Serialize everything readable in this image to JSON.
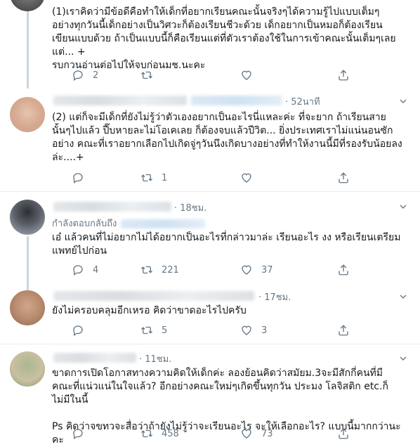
{
  "tweets": [
    {
      "time": "",
      "text": "(1)เราคิดว่ามีข้อดีคือทำให้เด็กที่อยากเรียนคณะนั้นจริงๆได้ความรู้ไปแบบเต็มๆ อย่างทุกวันนี้เด็กอย่างเป็นวิศวะก็ต้องเรียนชีวะด้วย เด็กอยากเป็นหมอก็ต้องเรียนเขียนแบบด้วย ถ้าเป็นแบบนี้ก็คือเรียนแต่ที่ตัวเราต้องใช้ในการเข้าคณะนั้นเต็มๆเลย แต่... +\nรบกวนอ่านต่อไปให้จบก่อนมช.นะคะ",
      "reply_count": "2",
      "retweet_count": "",
      "like_count": ""
    },
    {
      "time": "· 52นาที",
      "text": "(2) แต่ก็จะมีเด็กที่ยังไม่รู้ว่าตัวเองอยากเป็นอะไรนี่แหละค่ะ ที่จะยาก ถ้าเรียนสายนั้นๆไปแล้ว ปี๊บหายละไม่โอเคเลย ก็ต้องจบแล้วปีวิต... ยิ่งประเทศเราไม่แน่นอนซักอย่าง คณะที่เราอยากเลือกไปเกิดจู่ๆวันนึงเกิดบางอย่างที่ทำให้งานนี้มีที่รองรับน้อยลงล่ะ....+",
      "reply_count": "",
      "retweet_count": "1",
      "like_count": ""
    },
    {
      "time": "· 18ชม.",
      "replying_label": "กำลังตอบกลับถึง",
      "text": "เอ๋ แล้วคนที่ไม่อยากไม่ได้อยากเป็นอะไรที่กล่าวมาล่ะ เรียนอะไร งง หรือเรียนเตรียมแพทย์ไปก่อน",
      "reply_count": "4",
      "retweet_count": "221",
      "like_count": "37"
    },
    {
      "time": "· 17ชม.",
      "text": "ยังไม่ครอบคลุมอีกเหรอ คิดว่าขาดอะไรไปครับ",
      "reply_count": "",
      "retweet_count": "5",
      "like_count": "3"
    },
    {
      "time": "· 11ชม.",
      "text": "ขาดการเปิดโอกาสทางความคิดให้เด็กค่ะ ลองย้อนคิดว่าสมัยม.3จะมีสักกี่คนที่มีคณะที่แน่วแน่ในใจแล้ว? อีกอย่างคณะใหม่ๆเกิดขึ้นทุกวัน ประมง โลจิสติก etc.ก็ไม่มีในนี้\n\nPs คิดว่าจขทวจะสื่อว่าถ้ายังไม่รู้ว่าจะเรียนอะไร จะให้เลือกอะไร? แบบนี้มากกว่านะคะ",
      "reply_count": "",
      "retweet_count": "458",
      "like_count": "73"
    }
  ],
  "icons": {
    "reply": "reply-icon",
    "retweet": "retweet-icon",
    "like": "heart-icon",
    "share": "share-icon",
    "more": "chevron-down-icon"
  },
  "colors": {
    "text": "#14171a",
    "muted": "#657786",
    "link": "#1b95e0",
    "divider": "#e6ecf0"
  }
}
